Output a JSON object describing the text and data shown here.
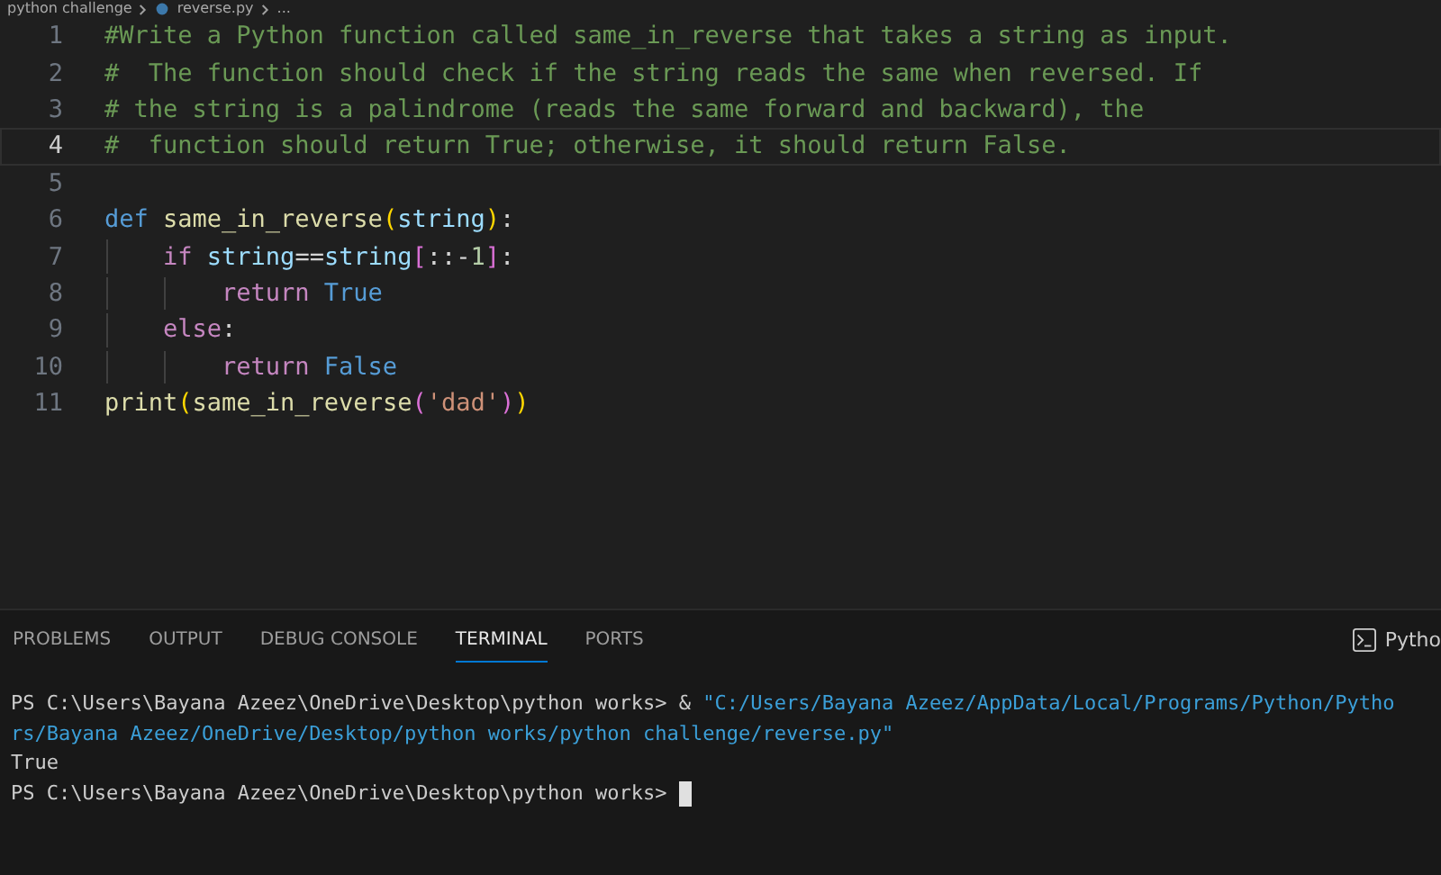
{
  "breadcrumb": [
    {
      "kind": "folder",
      "text": "python challenge"
    },
    {
      "kind": "file",
      "text": "reverse.py"
    },
    {
      "kind": "more",
      "text": "..."
    }
  ],
  "editor": {
    "lines": [
      {
        "number": "1",
        "current": false,
        "tokens": [
          {
            "kind": "comment",
            "text": "#Write a Python function called same_in_reverse that takes a string as input."
          }
        ]
      },
      {
        "number": "2",
        "current": false,
        "tokens": [
          {
            "kind": "comment",
            "text": "#  The function should check if the string reads the same when reversed. If"
          }
        ]
      },
      {
        "number": "3",
        "current": false,
        "tokens": [
          {
            "kind": "comment",
            "text": "# the string is a palindrome (reads the same forward and backward), the"
          }
        ]
      },
      {
        "number": "4",
        "current": true,
        "tokens": [
          {
            "kind": "comment",
            "text": "#  function should return True; otherwise, it should return False."
          }
        ]
      },
      {
        "number": "5",
        "current": false
      },
      {
        "number": "6",
        "current": false,
        "tokens": [
          {
            "kind": "storage",
            "text": "def "
          },
          {
            "kind": "function",
            "text": "same_in_reverse"
          },
          {
            "kind": "paren",
            "text": "("
          },
          {
            "kind": "variable",
            "text": "string"
          },
          {
            "kind": "paren",
            "text": ")"
          },
          {
            "kind": "plain",
            "text": ":"
          }
        ]
      },
      {
        "number": "7",
        "current": false,
        "tokens": [
          {
            "kind": "control",
            "text": "    if "
          },
          {
            "kind": "variable",
            "text": "string"
          },
          {
            "kind": "plain",
            "text": "=="
          },
          {
            "kind": "variable",
            "text": "string"
          },
          {
            "kind": "bracket",
            "text": "["
          },
          {
            "kind": "plain",
            "text": "::-"
          },
          {
            "kind": "number",
            "text": "1"
          },
          {
            "kind": "bracket",
            "text": "]"
          },
          {
            "kind": "plain",
            "text": ":"
          }
        ]
      },
      {
        "number": "8",
        "current": false,
        "tokens": [
          {
            "kind": "control",
            "text": "        return "
          },
          {
            "kind": "constant",
            "text": "True"
          }
        ]
      },
      {
        "number": "9",
        "current": false,
        "tokens": [
          {
            "kind": "control",
            "text": "    else"
          },
          {
            "kind": "plain",
            "text": ":"
          }
        ]
      },
      {
        "number": "10",
        "current": false,
        "tokens": [
          {
            "kind": "control",
            "text": "        return "
          },
          {
            "kind": "constant",
            "text": "False"
          }
        ]
      },
      {
        "number": "11",
        "current": false,
        "tokens": [
          {
            "kind": "function",
            "text": "print"
          },
          {
            "kind": "paren",
            "text": "("
          },
          {
            "kind": "function",
            "text": "same_in_reverse"
          },
          {
            "kind": "bracket",
            "text": "("
          },
          {
            "kind": "string",
            "text": "'dad'"
          },
          {
            "kind": "bracket",
            "text": ")"
          },
          {
            "kind": "paren",
            "text": ")"
          }
        ]
      }
    ]
  },
  "panel": {
    "tabs": [
      {
        "label": "PROBLEMS",
        "selected": false
      },
      {
        "label": "OUTPUT",
        "selected": false
      },
      {
        "label": "DEBUG CONSOLE",
        "selected": false
      },
      {
        "label": "TERMINAL",
        "selected": true
      },
      {
        "label": "PORTS",
        "selected": false
      }
    ],
    "shell_label": "Pytho",
    "terminal": [
      {
        "segments": [
          {
            "kind": "plain",
            "text": "PS C:\\Users\\Bayana Azeez\\OneDrive\\Desktop\\python works> & "
          },
          {
            "kind": "string",
            "text": "\"C:/Users/Bayana Azeez/AppData/Local/Programs/Python/Pytho"
          }
        ]
      },
      {
        "segments": [
          {
            "kind": "string",
            "text": "rs/Bayana Azeez/OneDrive/Desktop/python works/python challenge/reverse.py\""
          }
        ]
      },
      {
        "segments": [
          {
            "kind": "plain",
            "text": "True"
          }
        ]
      },
      {
        "segments": [
          {
            "kind": "plain",
            "text": "PS C:\\Users\\Bayana Azeez\\OneDrive\\Desktop\\python works> "
          }
        ],
        "cursor": true
      }
    ]
  }
}
